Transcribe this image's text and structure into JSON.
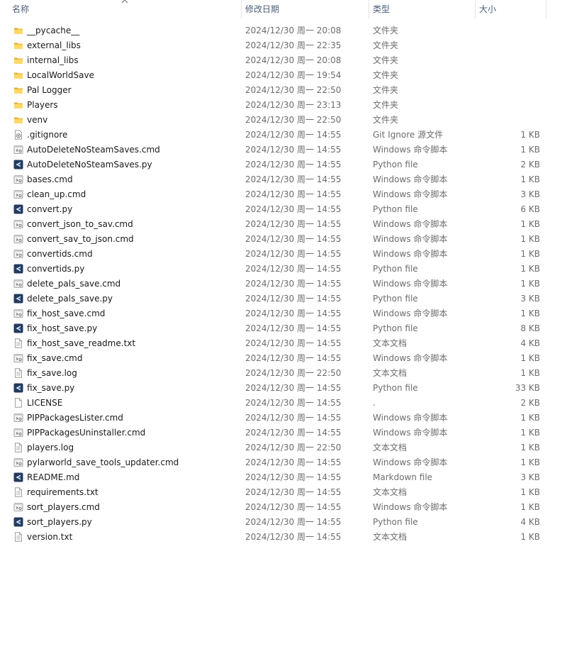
{
  "columns": {
    "name": "名称",
    "modified": "修改日期",
    "type": "类型",
    "size": "大小"
  },
  "files": [
    {
      "name": "__pycache__",
      "modified": "2024/12/30 周一 20:08",
      "type": "文件夹",
      "size": "",
      "icon": "folder"
    },
    {
      "name": "external_libs",
      "modified": "2024/12/30 周一 22:35",
      "type": "文件夹",
      "size": "",
      "icon": "folder"
    },
    {
      "name": "internal_libs",
      "modified": "2024/12/30 周一 20:08",
      "type": "文件夹",
      "size": "",
      "icon": "folder"
    },
    {
      "name": "LocalWorldSave",
      "modified": "2024/12/30 周一 19:54",
      "type": "文件夹",
      "size": "",
      "icon": "folder"
    },
    {
      "name": "Pal Logger",
      "modified": "2024/12/30 周一 22:50",
      "type": "文件夹",
      "size": "",
      "icon": "folder"
    },
    {
      "name": "Players",
      "modified": "2024/12/30 周一 23:13",
      "type": "文件夹",
      "size": "",
      "icon": "folder"
    },
    {
      "name": "venv",
      "modified": "2024/12/30 周一 22:50",
      "type": "文件夹",
      "size": "",
      "icon": "folder"
    },
    {
      "name": ".gitignore",
      "modified": "2024/12/30 周一 14:55",
      "type": "Git Ignore 源文件",
      "size": "1 KB",
      "icon": "config"
    },
    {
      "name": "AutoDeleteNoSteamSaves.cmd",
      "modified": "2024/12/30 周一 14:55",
      "type": "Windows 命令脚本",
      "size": "1 KB",
      "icon": "script"
    },
    {
      "name": "AutoDeleteNoSteamSaves.py",
      "modified": "2024/12/30 周一 14:55",
      "type": "Python file",
      "size": "2 KB",
      "icon": "python"
    },
    {
      "name": "bases.cmd",
      "modified": "2024/12/30 周一 14:55",
      "type": "Windows 命令脚本",
      "size": "1 KB",
      "icon": "script"
    },
    {
      "name": "clean_up.cmd",
      "modified": "2024/12/30 周一 14:55",
      "type": "Windows 命令脚本",
      "size": "3 KB",
      "icon": "script"
    },
    {
      "name": "convert.py",
      "modified": "2024/12/30 周一 14:55",
      "type": "Python file",
      "size": "6 KB",
      "icon": "python"
    },
    {
      "name": "convert_json_to_sav.cmd",
      "modified": "2024/12/30 周一 14:55",
      "type": "Windows 命令脚本",
      "size": "1 KB",
      "icon": "script"
    },
    {
      "name": "convert_sav_to_json.cmd",
      "modified": "2024/12/30 周一 14:55",
      "type": "Windows 命令脚本",
      "size": "1 KB",
      "icon": "script"
    },
    {
      "name": "convertids.cmd",
      "modified": "2024/12/30 周一 14:55",
      "type": "Windows 命令脚本",
      "size": "1 KB",
      "icon": "script"
    },
    {
      "name": "convertids.py",
      "modified": "2024/12/30 周一 14:55",
      "type": "Python file",
      "size": "1 KB",
      "icon": "python"
    },
    {
      "name": "delete_pals_save.cmd",
      "modified": "2024/12/30 周一 14:55",
      "type": "Windows 命令脚本",
      "size": "1 KB",
      "icon": "script"
    },
    {
      "name": "delete_pals_save.py",
      "modified": "2024/12/30 周一 14:55",
      "type": "Python file",
      "size": "3 KB",
      "icon": "python"
    },
    {
      "name": "fix_host_save.cmd",
      "modified": "2024/12/30 周一 14:55",
      "type": "Windows 命令脚本",
      "size": "1 KB",
      "icon": "script"
    },
    {
      "name": "fix_host_save.py",
      "modified": "2024/12/30 周一 14:55",
      "type": "Python file",
      "size": "8 KB",
      "icon": "python"
    },
    {
      "name": "fix_host_save_readme.txt",
      "modified": "2024/12/30 周一 14:55",
      "type": "文本文档",
      "size": "4 KB",
      "icon": "text"
    },
    {
      "name": "fix_save.cmd",
      "modified": "2024/12/30 周一 14:55",
      "type": "Windows 命令脚本",
      "size": "1 KB",
      "icon": "script"
    },
    {
      "name": "fix_save.log",
      "modified": "2024/12/30 周一 22:50",
      "type": "文本文档",
      "size": "1 KB",
      "icon": "text"
    },
    {
      "name": "fix_save.py",
      "modified": "2024/12/30 周一 14:55",
      "type": "Python file",
      "size": "33 KB",
      "icon": "python"
    },
    {
      "name": "LICENSE",
      "modified": "2024/12/30 周一 14:55",
      "type": ".",
      "size": "2 KB",
      "icon": "blank"
    },
    {
      "name": "PIPPackagesLister.cmd",
      "modified": "2024/12/30 周一 14:55",
      "type": "Windows 命令脚本",
      "size": "1 KB",
      "icon": "script"
    },
    {
      "name": "PIPPackagesUninstaller.cmd",
      "modified": "2024/12/30 周一 14:55",
      "type": "Windows 命令脚本",
      "size": "1 KB",
      "icon": "script"
    },
    {
      "name": "players.log",
      "modified": "2024/12/30 周一 22:50",
      "type": "文本文档",
      "size": "1 KB",
      "icon": "text"
    },
    {
      "name": "pylarworld_save_tools_updater.cmd",
      "modified": "2024/12/30 周一 14:55",
      "type": "Windows 命令脚本",
      "size": "1 KB",
      "icon": "script"
    },
    {
      "name": "README.md",
      "modified": "2024/12/30 周一 14:55",
      "type": "Markdown file",
      "size": "3 KB",
      "icon": "python"
    },
    {
      "name": "requirements.txt",
      "modified": "2024/12/30 周一 14:55",
      "type": "文本文档",
      "size": "1 KB",
      "icon": "text"
    },
    {
      "name": "sort_players.cmd",
      "modified": "2024/12/30 周一 14:55",
      "type": "Windows 命令脚本",
      "size": "1 KB",
      "icon": "script"
    },
    {
      "name": "sort_players.py",
      "modified": "2024/12/30 周一 14:55",
      "type": "Python file",
      "size": "4 KB",
      "icon": "python"
    },
    {
      "name": "version.txt",
      "modified": "2024/12/30 周一 14:55",
      "type": "文本文档",
      "size": "1 KB",
      "icon": "text"
    }
  ]
}
